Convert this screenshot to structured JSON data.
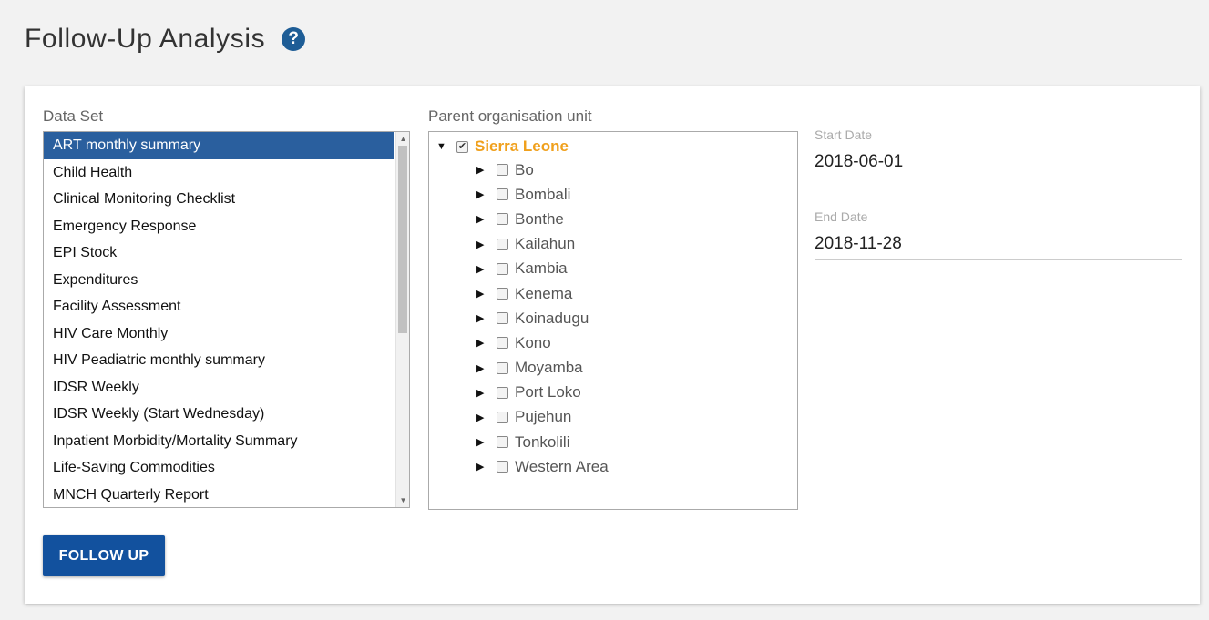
{
  "page": {
    "title": "Follow-Up Analysis",
    "help_glyph": "?"
  },
  "dataset": {
    "label": "Data Set",
    "options": [
      "ART monthly summary",
      "Child Health",
      "Clinical Monitoring Checklist",
      "Emergency Response",
      "EPI Stock",
      "Expenditures",
      "Facility Assessment",
      "HIV Care Monthly",
      "HIV Peadiatric monthly summary",
      "IDSR Weekly",
      "IDSR Weekly (Start Wednesday)",
      "Inpatient Morbidity/Mortality Summary",
      "Life-Saving Commodities",
      "MNCH Quarterly Report"
    ],
    "selected": "ART monthly summary"
  },
  "org_unit": {
    "label": "Parent organisation unit",
    "root": {
      "name": "Sierra Leone",
      "checked": true,
      "expanded": true
    },
    "children": [
      "Bo",
      "Bombali",
      "Bonthe",
      "Kailahun",
      "Kambia",
      "Kenema",
      "Koinadugu",
      "Kono",
      "Moyamba",
      "Port Loko",
      "Pujehun",
      "Tonkolili",
      "Western Area"
    ]
  },
  "dates": {
    "start_label": "Start Date",
    "start_value": "2018-06-01",
    "end_label": "End Date",
    "end_value": "2018-11-28"
  },
  "actions": {
    "follow_up_label": "FOLLOW UP"
  },
  "colors": {
    "accent": "#2a5f9e",
    "button": "#12519e",
    "root_node": "#f0a01c",
    "help_icon": "#1e5d96"
  },
  "icons": {
    "help": "question-circle-icon",
    "expand": "triangle-right-icon",
    "collapse": "triangle-down-icon"
  }
}
